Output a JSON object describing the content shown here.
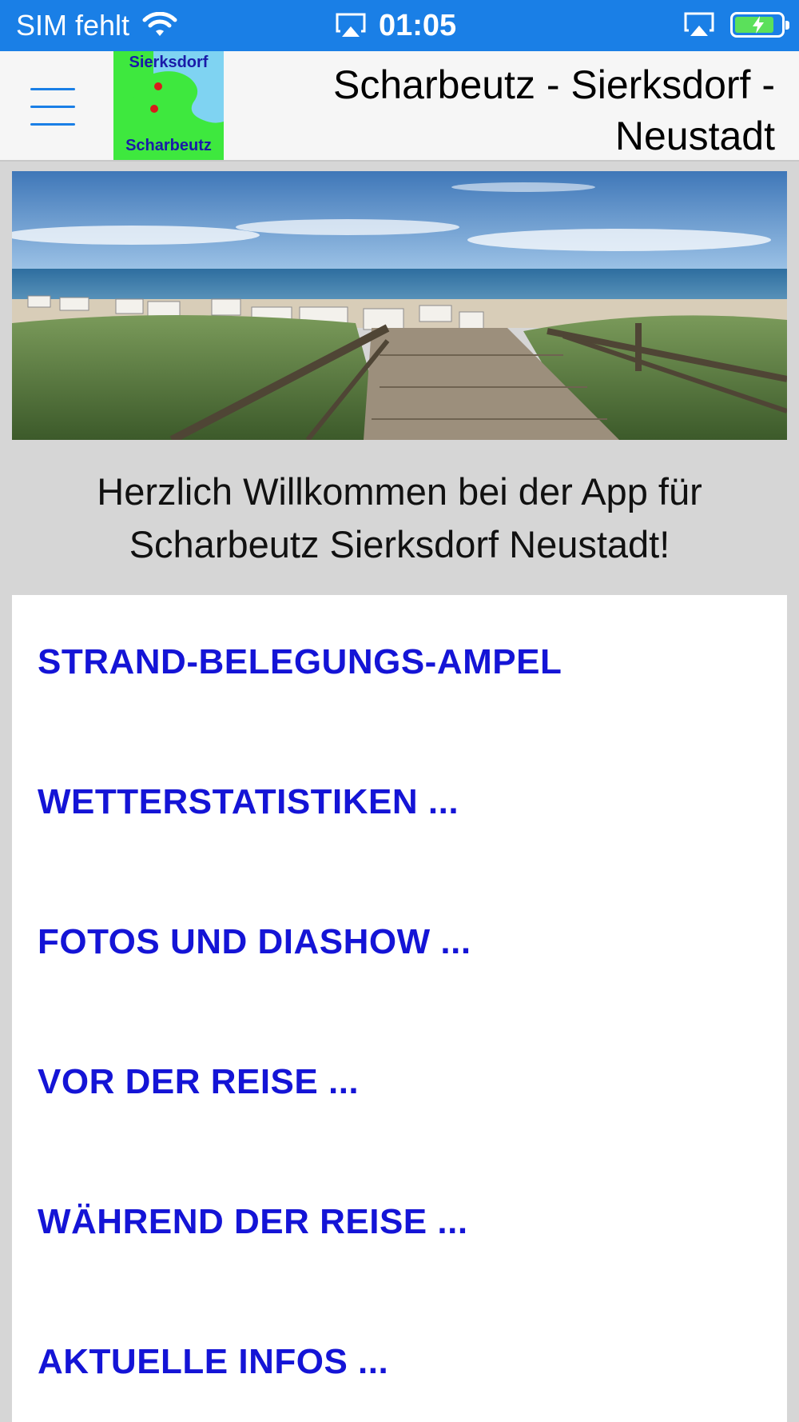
{
  "status_bar": {
    "carrier": "SIM fehlt",
    "time": "01:05",
    "battery_level": 0.85,
    "colors": {
      "background": "#1a7fe6",
      "battery_fill": "#5be05b"
    },
    "icons": [
      "wifi-icon",
      "airplay-icon",
      "battery-icon",
      "charging-bolt-icon"
    ]
  },
  "header": {
    "title": "Scharbeutz - Sierksdorf - Neustadt",
    "menu_icon": "hamburger-menu-icon",
    "logo": {
      "top_label": "Sierksdorf",
      "bottom_label": "Scharbeutz"
    }
  },
  "hero": {
    "description_icon": "beach-photo"
  },
  "welcome": {
    "line1": "Herzlich Willkommen bei der App für",
    "line2": "Scharbeutz Sierksdorf Neustadt!"
  },
  "menu": {
    "items": [
      {
        "label": "STRAND-BELEGUNGS-AMPEL"
      },
      {
        "label": "WETTERSTATISTIKEN ..."
      },
      {
        "label": "FOTOS UND DIASHOW ..."
      },
      {
        "label": "VOR DER REISE ..."
      },
      {
        "label": "WÄHREND DER REISE ..."
      },
      {
        "label": "AKTUELLE INFOS ..."
      }
    ],
    "link_color": "#1414d6"
  }
}
